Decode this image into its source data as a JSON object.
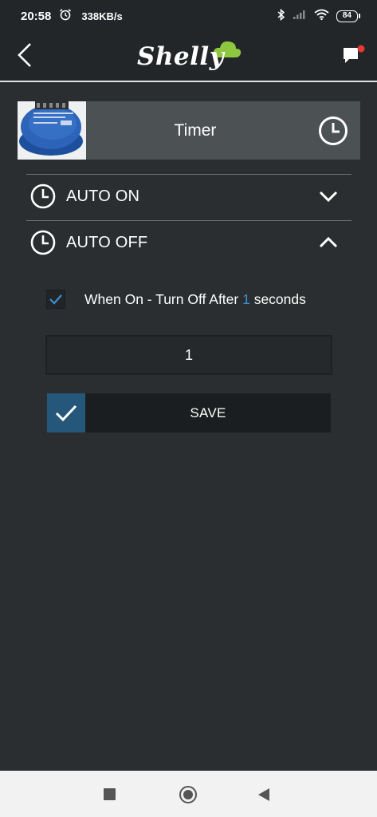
{
  "status_bar": {
    "time": "20:58",
    "speed": "338KB/s",
    "battery": "84",
    "icons": [
      "alarm-icon",
      "bluetooth-icon",
      "signal-icon",
      "wifi-icon",
      "battery-icon"
    ]
  },
  "header": {
    "logo_text": "Shelly",
    "back_icon": "chevron-left-icon",
    "chat_icon": "chat-notification-icon",
    "notification_color": "#e53935"
  },
  "device": {
    "title": "Timer",
    "image": "shelly-device-photo",
    "icon": "clock-icon"
  },
  "sections": {
    "auto_on": {
      "label": "AUTO ON",
      "expanded": false,
      "icon": "chevron-down-icon"
    },
    "auto_off": {
      "label": "AUTO OFF",
      "expanded": true,
      "icon": "chevron-up-icon"
    }
  },
  "auto_off": {
    "checked": true,
    "text_before": "When On - Turn Off After ",
    "value_inline": "1",
    "text_after": " seconds",
    "input_value": "1",
    "save_label": "SAVE"
  },
  "colors": {
    "background": "#2a2e30",
    "header": "#232628",
    "device_row": "#4c5154",
    "accent": "#3b8fd1",
    "save_check": "#245779",
    "save_button": "#1b1e20"
  },
  "nav_bar": {
    "icons": [
      "recents-square-icon",
      "home-circle-icon",
      "back-triangle-icon"
    ]
  }
}
